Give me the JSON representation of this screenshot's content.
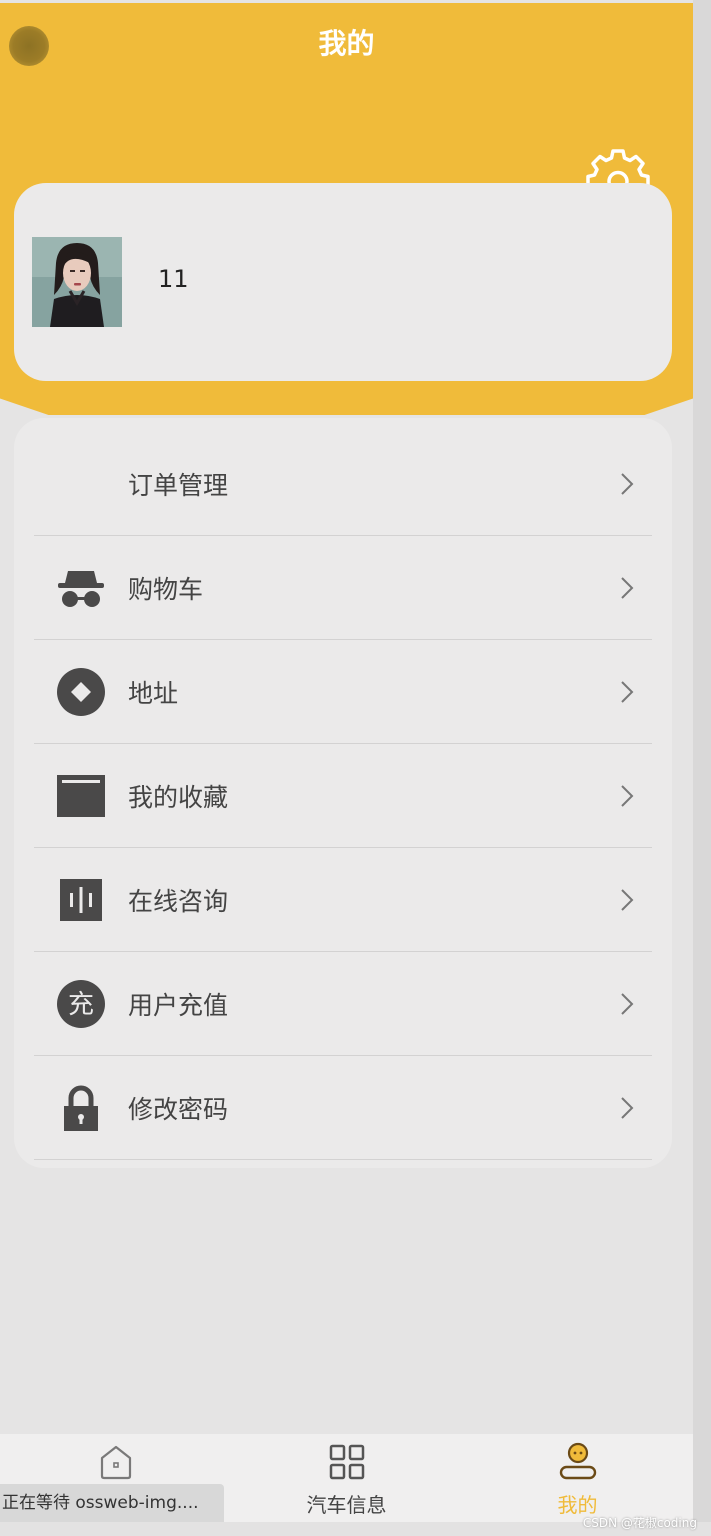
{
  "header": {
    "title": "我的"
  },
  "profile": {
    "username": "11"
  },
  "menu": {
    "items": [
      {
        "label": "订单管理",
        "icon": "order-icon"
      },
      {
        "label": "购物车",
        "icon": "incognito-icon"
      },
      {
        "label": "地址",
        "icon": "diamond-circle-icon"
      },
      {
        "label": "我的收藏",
        "icon": "bookmark-box-icon"
      },
      {
        "label": "在线咨询",
        "icon": "voice-wave-icon"
      },
      {
        "label": "用户充值",
        "icon": "recharge-icon",
        "glyph": "充"
      },
      {
        "label": "修改密码",
        "icon": "lock-icon"
      }
    ]
  },
  "tabbar": {
    "tabs": [
      {
        "label": "",
        "icon": "home-icon"
      },
      {
        "label": "汽车信息",
        "icon": "grid-icon"
      },
      {
        "label": "我的",
        "icon": "user-icon",
        "active": true
      }
    ]
  },
  "status": {
    "text": "正在等待 ossweb-img...."
  },
  "watermark": {
    "text": "CSDN @花椒coding"
  },
  "colors": {
    "accent": "#f0bb3a",
    "icon": "#4a4949",
    "card": "#ebeaea"
  }
}
